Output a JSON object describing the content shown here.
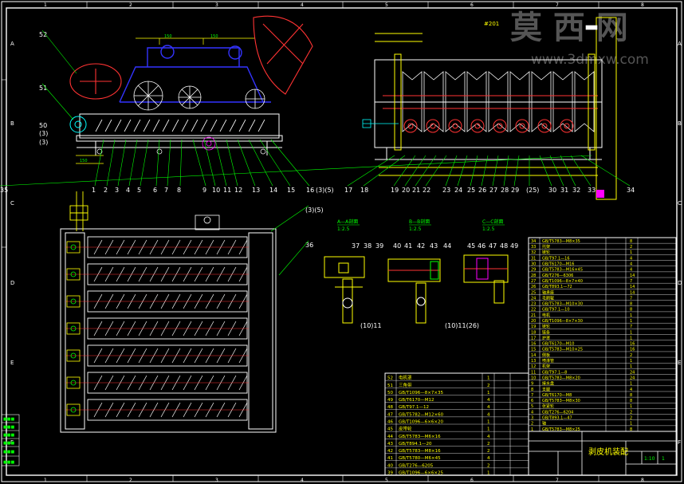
{
  "grid": {
    "columns": [
      "1",
      "2",
      "3",
      "4",
      "5",
      "6",
      "7",
      "8"
    ],
    "rows": [
      "A",
      "B",
      "C",
      "D",
      "E",
      "F"
    ]
  },
  "watermark": {
    "main": "莫 西 网",
    "url": "www.3dmxw.com"
  },
  "top_marker": "#201",
  "callouts_top_left": [
    "52",
    "51",
    "50",
    "(3)",
    "(3)"
  ],
  "callouts_top_row": [
    "1",
    "2",
    "3",
    "4",
    "5",
    "6",
    "7",
    "8",
    "9",
    "10",
    "11",
    "12",
    "13",
    "14",
    "15",
    "16",
    "(3)",
    "(5)",
    "17",
    "18",
    "19",
    "20",
    "21",
    "22",
    "23",
    "24",
    "25",
    "26",
    "27",
    "28",
    "29",
    "(25)",
    "30",
    "31",
    "32",
    "33",
    "34",
    "35"
  ],
  "callouts_mid": [
    "(3)",
    "(5)",
    "36",
    "37",
    "38",
    "39",
    "40",
    "41",
    "42",
    "43",
    "44",
    "45",
    "46",
    "47",
    "48",
    "49"
  ],
  "callouts_sub": [
    "(10)",
    "11",
    "(10)",
    "11",
    "(26)"
  ],
  "sections": [
    {
      "title": "A—A剖面",
      "scale": "1:2.5"
    },
    {
      "title": "B—B剖面",
      "scale": "1:2.5"
    },
    {
      "title": "C—C剖面",
      "scale": "1:2.5"
    }
  ],
  "bom_right": [
    {
      "no": "34",
      "name": "GB/T5783—M8×35",
      "qty": "8"
    },
    {
      "no": "33",
      "name": "托架",
      "qty": "2"
    },
    {
      "no": "32",
      "name": "链轮",
      "qty": "1"
    },
    {
      "no": "31",
      "name": "GB/T97.1—16",
      "qty": "4"
    },
    {
      "no": "30",
      "name": "GB/T6170—M16",
      "qty": "4"
    },
    {
      "no": "29",
      "name": "GB/T5783—M16×45",
      "qty": "4"
    },
    {
      "no": "28",
      "name": "GB/T276—6306",
      "qty": "14"
    },
    {
      "no": "27",
      "name": "GB/T1096—8×7×40",
      "qty": "7"
    },
    {
      "no": "26",
      "name": "GB/T893.1—72",
      "qty": "14"
    },
    {
      "no": "25",
      "name": "轴承座",
      "qty": "14"
    },
    {
      "no": "24",
      "name": "毛刷辊",
      "qty": "7"
    },
    {
      "no": "23",
      "name": "GB/T5783—M10×30",
      "qty": "8"
    },
    {
      "no": "22",
      "name": "GB/T97.1—10",
      "qty": "8"
    },
    {
      "no": "21",
      "name": "电机",
      "qty": "1"
    },
    {
      "no": "20",
      "name": "GB/T1096—8×7×30",
      "qty": "1"
    },
    {
      "no": "19",
      "name": "链轮",
      "qty": "7"
    },
    {
      "no": "18",
      "name": "链条",
      "qty": "1"
    },
    {
      "no": "17",
      "name": "护罩",
      "qty": "1"
    },
    {
      "no": "16",
      "name": "GB/T6170—M10",
      "qty": "16"
    },
    {
      "no": "15",
      "name": "GB/T5783—M10×25",
      "qty": "16"
    },
    {
      "no": "14",
      "name": "侧板",
      "qty": "2"
    },
    {
      "no": "13",
      "name": "喷淋管",
      "qty": "1"
    },
    {
      "no": "12",
      "name": "机架",
      "qty": "1"
    },
    {
      "no": "11",
      "name": "GB/T97.1—8",
      "qty": "24"
    },
    {
      "no": "10",
      "name": "GB/T5783—M8×20",
      "qty": "24"
    },
    {
      "no": "9",
      "name": "接水盘",
      "qty": "1"
    },
    {
      "no": "8",
      "name": "支腿",
      "qty": "4"
    },
    {
      "no": "7",
      "name": "GB/T6170—M8",
      "qty": "8"
    },
    {
      "no": "6",
      "name": "GB/T5783—M8×30",
      "qty": "8"
    },
    {
      "no": "5",
      "name": "张紧轮",
      "qty": "1"
    },
    {
      "no": "4",
      "name": "GB/T276—6204",
      "qty": "2"
    },
    {
      "no": "3",
      "name": "GB/T893.1—47",
      "qty": "2"
    },
    {
      "no": "2",
      "name": "轴",
      "qty": "1"
    },
    {
      "no": "1",
      "name": "GB/T5783—M8×25",
      "qty": "8"
    }
  ],
  "bom_bottom": [
    {
      "no": "52",
      "name": "电机罩",
      "qty": "1"
    },
    {
      "no": "51",
      "name": "三角带",
      "qty": "2"
    },
    {
      "no": "50",
      "name": "GB/T1096—8×7×35",
      "qty": "1"
    },
    {
      "no": "49",
      "name": "GB/T6170—M12",
      "qty": "4"
    },
    {
      "no": "48",
      "name": "GB/T97.1—12",
      "qty": "4"
    },
    {
      "no": "47",
      "name": "GB/T5782—M12×60",
      "qty": "4"
    },
    {
      "no": "46",
      "name": "GB/T1096—6×6×20",
      "qty": "1"
    },
    {
      "no": "45",
      "name": "皮带轮",
      "qty": "1"
    },
    {
      "no": "44",
      "name": "GB/T5783—M6×16",
      "qty": "4"
    },
    {
      "no": "43",
      "name": "GB/T894.1—20",
      "qty": "2"
    },
    {
      "no": "42",
      "name": "GB/T5783—M8×16",
      "qty": "2"
    },
    {
      "no": "41",
      "name": "GB/T5780—M6×45",
      "qty": "4"
    },
    {
      "no": "40",
      "name": "GB/T276—6205",
      "qty": "2"
    },
    {
      "no": "39",
      "name": "GB/T1096—6×6×25",
      "qty": "1"
    }
  ],
  "title_block": {
    "title": "剥皮机装配",
    "scale": "1:10",
    "sheet": "1"
  }
}
